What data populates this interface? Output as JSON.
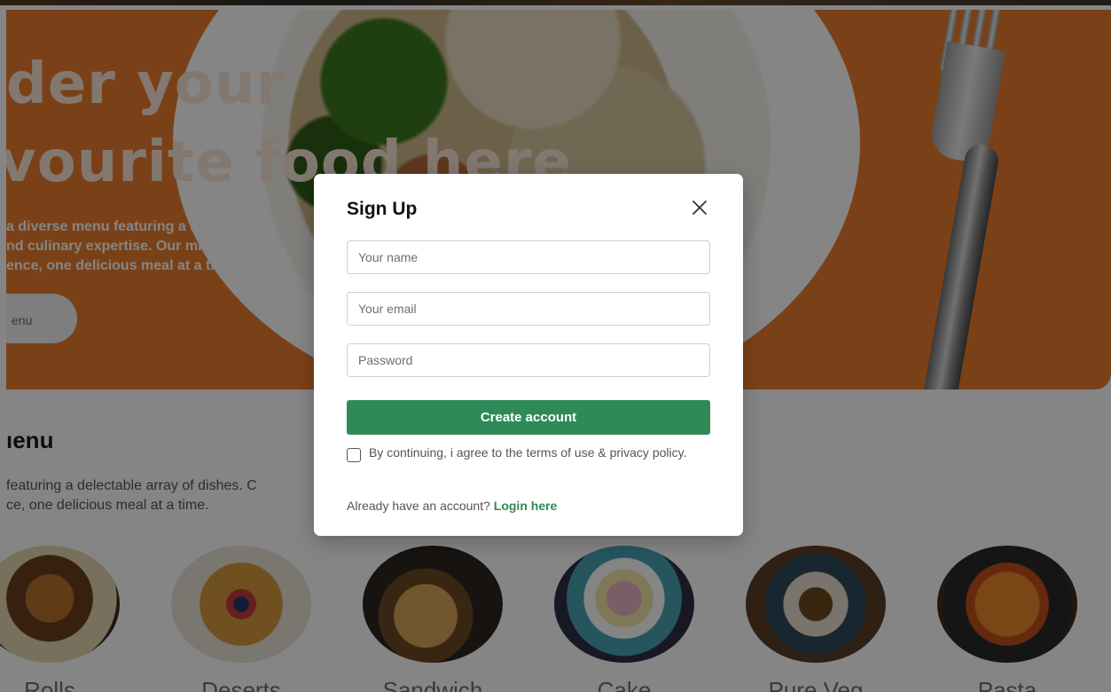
{
  "hero": {
    "title_line1": "der your",
    "title_line2": "vourite food here",
    "description_lines": [
      "a diverse menu featuring a delectabl",
      "nd culinary expertise. Our mission is t",
      "ence, one delicious meal at a time."
    ],
    "button_label": "enu"
  },
  "menu": {
    "title": "ıenu",
    "description_lines": [
      "featuring a delectable array of dishes. C",
      "ce, one delicious meal at a time."
    ],
    "categories": [
      {
        "label": "Rolls",
        "image": "rolls-photo"
      },
      {
        "label": "Deserts",
        "image": "deserts-photo"
      },
      {
        "label": "Sandwich",
        "image": "sandwich-photo"
      },
      {
        "label": "Cake",
        "image": "cake-photo"
      },
      {
        "label": "Pure Veg",
        "image": "pure-veg-photo"
      },
      {
        "label": "Pasta",
        "image": "pasta-photo"
      }
    ]
  },
  "modal": {
    "title": "Sign Up",
    "close_icon": "close-icon",
    "name_placeholder": "Your name",
    "email_placeholder": "Your email",
    "password_placeholder": "Password",
    "create_button": "Create account",
    "terms_text": "By continuing, i agree to the terms of use & privacy policy.",
    "terms_checked": false,
    "login_prompt": "Already have an account?",
    "login_link": "Login here"
  },
  "colors": {
    "accent_green": "#2e8b57",
    "hero_orange": "#ea7d2e",
    "overlay": "rgba(0,0,0,0.48)"
  }
}
